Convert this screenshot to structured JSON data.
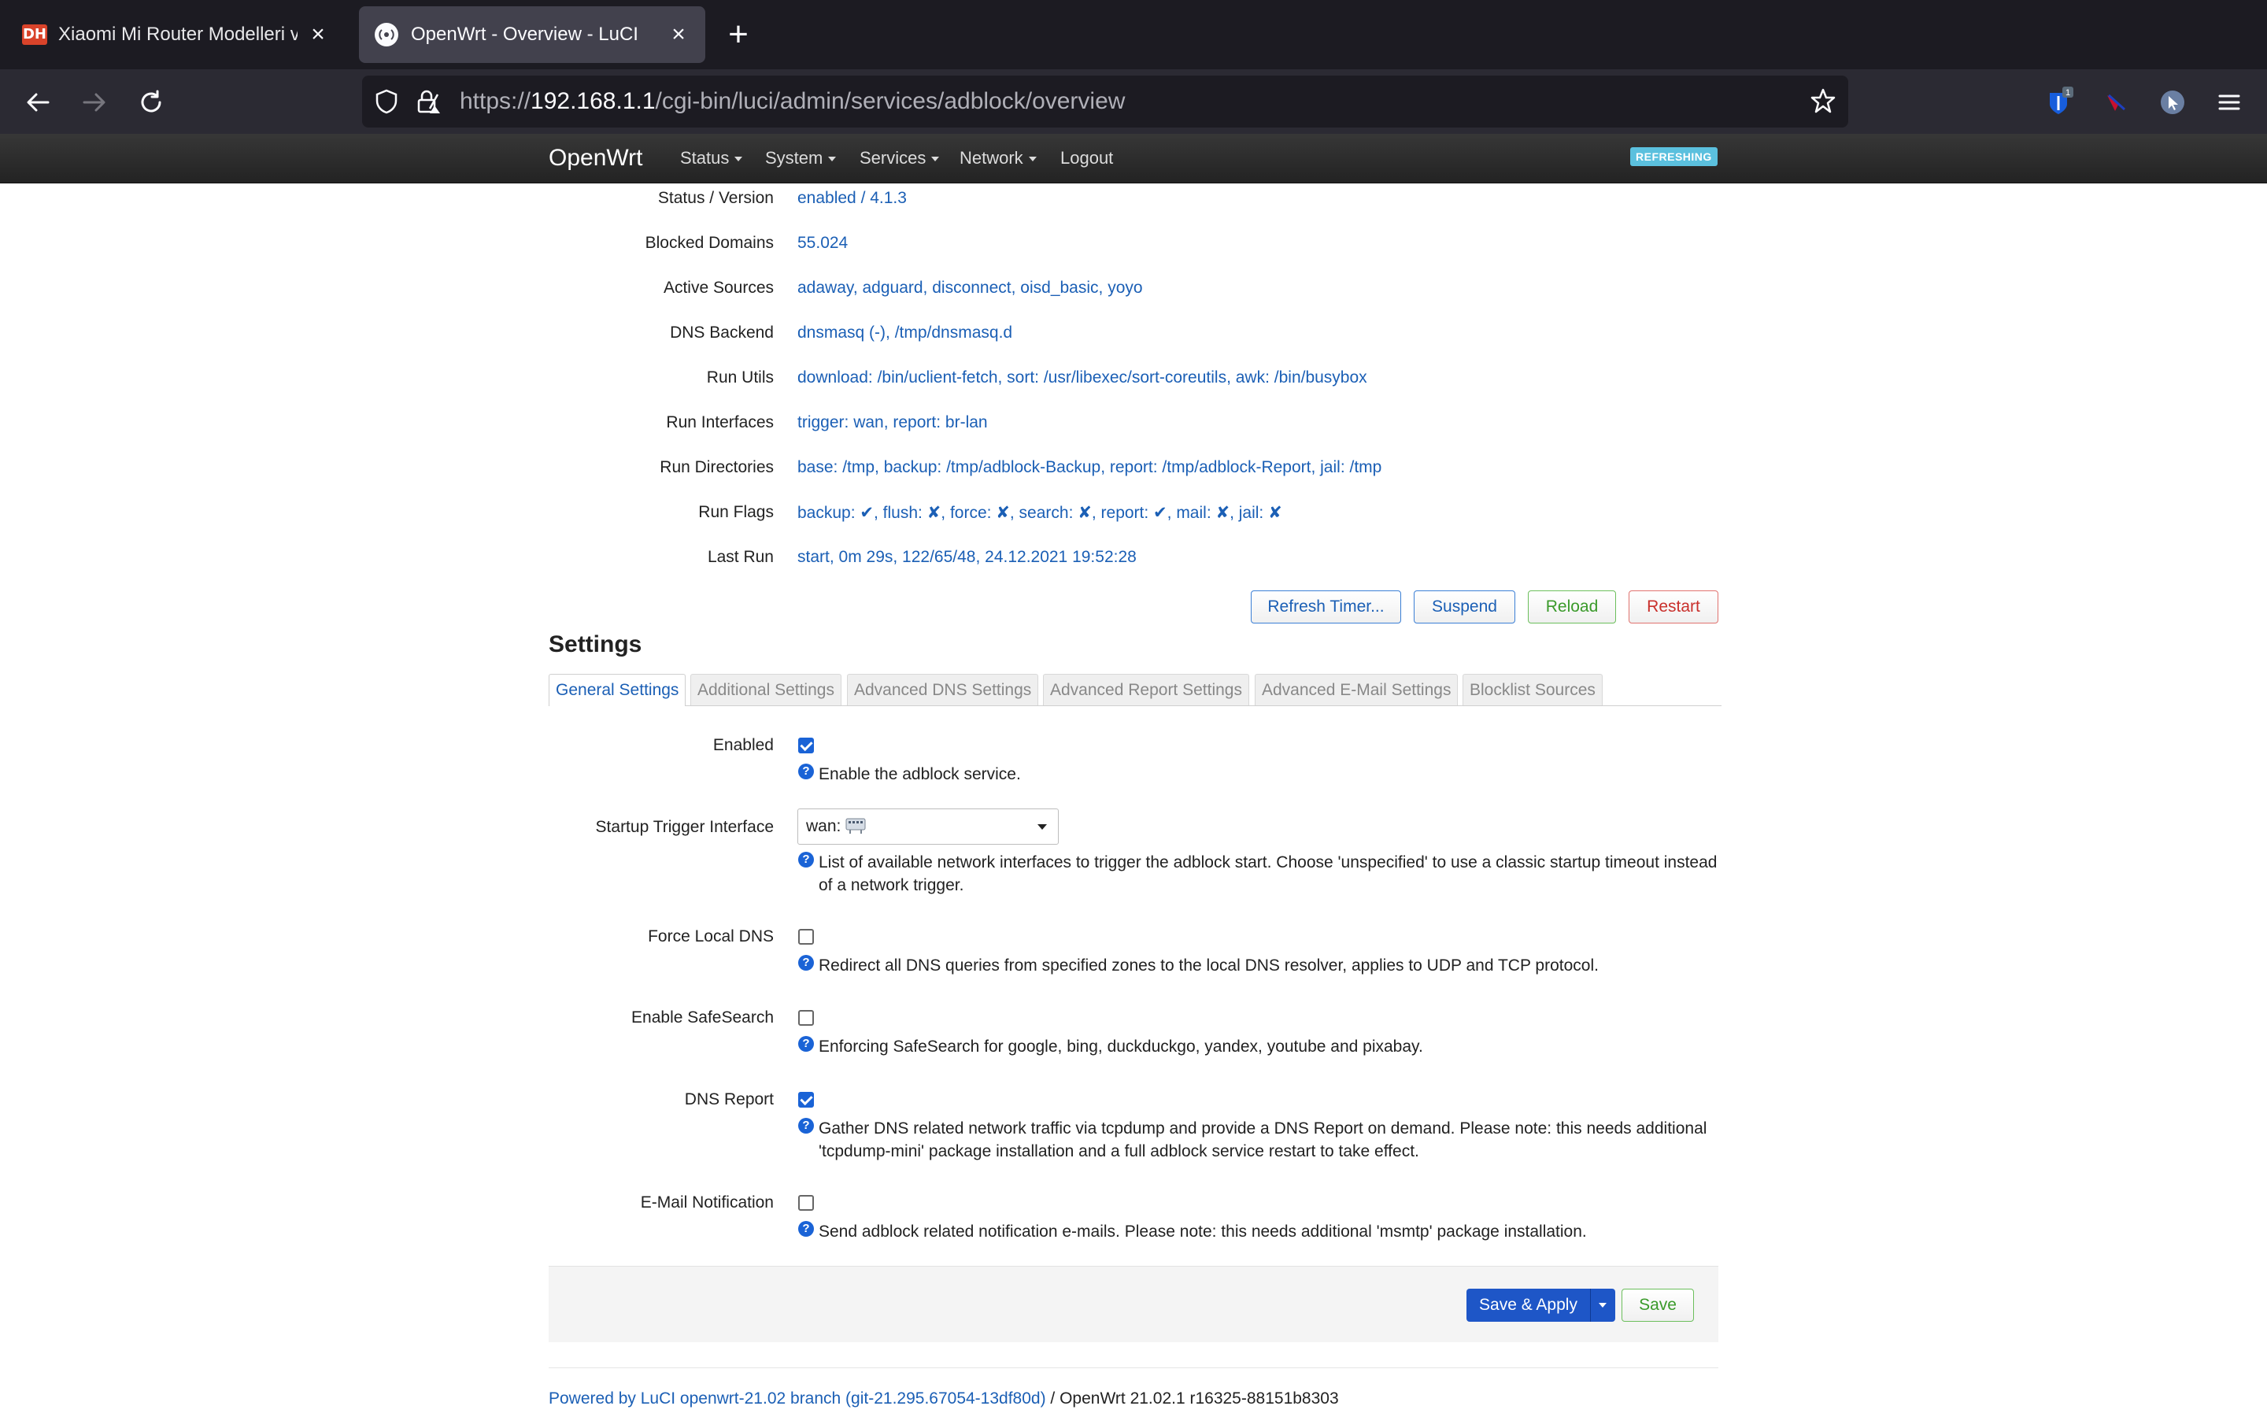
{
  "browser": {
    "tabs": [
      {
        "title": "Xiaomi Mi Router Modelleri ve O",
        "favicon": "DH",
        "active": false
      },
      {
        "title": "OpenWrt - Overview - LuCI",
        "active": true
      }
    ],
    "url_prefix": "https://",
    "url_host": "192.168.1.1",
    "url_path": "/cgi-bin/luci/admin/services/adblock/overview",
    "extension_badge": "1"
  },
  "header": {
    "brand": "OpenWrt",
    "menu": [
      "Status",
      "System",
      "Services",
      "Network",
      "Logout"
    ],
    "refreshing_badge": "REFRESHING"
  },
  "status": [
    {
      "label": "Status / Version",
      "value": "enabled / 4.1.3"
    },
    {
      "label": "Blocked Domains",
      "value": "55.024"
    },
    {
      "label": "Active Sources",
      "value": "adaway, adguard, disconnect, oisd_basic, yoyo"
    },
    {
      "label": "DNS Backend",
      "value": "dnsmasq (-), /tmp/dnsmasq.d"
    },
    {
      "label": "Run Utils",
      "value": "download: /bin/uclient-fetch, sort: /usr/libexec/sort-coreutils, awk: /bin/busybox"
    },
    {
      "label": "Run Interfaces",
      "value": "trigger: wan, report: br-lan"
    },
    {
      "label": "Run Directories",
      "value": "base: /tmp, backup: /tmp/adblock-Backup, report: /tmp/adblock-Report, jail: /tmp"
    },
    {
      "label": "Run Flags",
      "value": "backup: ✔, flush: ✘, force: ✘, search: ✘, report: ✔, mail: ✘, jail: ✘"
    },
    {
      "label": "Last Run",
      "value": "start, 0m 29s, 122/65/48, 24.12.2021 19:52:28"
    }
  ],
  "actions": {
    "refresh_timer": "Refresh Timer...",
    "suspend": "Suspend",
    "reload": "Reload",
    "restart": "Restart"
  },
  "settings": {
    "title": "Settings",
    "tabs": [
      "General Settings",
      "Additional Settings",
      "Advanced DNS Settings",
      "Advanced Report Settings",
      "Advanced E-Mail Settings",
      "Blocklist Sources"
    ],
    "active_tab": "General Settings",
    "fields": {
      "enabled": {
        "label": "Enabled",
        "checked": true,
        "desc": "Enable the adblock service."
      },
      "trigger": {
        "label": "Startup Trigger Interface",
        "value": "wan:",
        "desc": "List of available network interfaces to trigger the adblock start. Choose 'unspecified' to use a classic startup timeout instead of a network trigger."
      },
      "force_dns": {
        "label": "Force Local DNS",
        "checked": false,
        "desc": "Redirect all DNS queries from specified zones to the local DNS resolver, applies to UDP and TCP protocol."
      },
      "safesearch": {
        "label": "Enable SafeSearch",
        "checked": false,
        "desc": "Enforcing SafeSearch for google, bing, duckduckgo, yandex, youtube and pixabay."
      },
      "dns_report": {
        "label": "DNS Report",
        "checked": true,
        "desc": "Gather DNS related network traffic via tcpdump and provide a DNS Report on demand. Please note: this needs additional 'tcpdump-mini' package installation and a full adblock service restart to take effect."
      },
      "email": {
        "label": "E-Mail Notification",
        "checked": false,
        "desc": "Send adblock related notification e-mails. Please note: this needs additional 'msmtp' package installation."
      }
    }
  },
  "save_apply": "Save & Apply",
  "save": "Save",
  "footer": {
    "link": "Powered by LuCI openwrt-21.02 branch (git-21.295.67054-13df80d)",
    "text": " / OpenWrt 21.02.1 r16325-88151b8303"
  },
  "colors": {
    "link": "#1b5fb5",
    "primary": "#1e56c7",
    "checkbox": "#1a63d6",
    "refreshing": "#5bc0de"
  }
}
